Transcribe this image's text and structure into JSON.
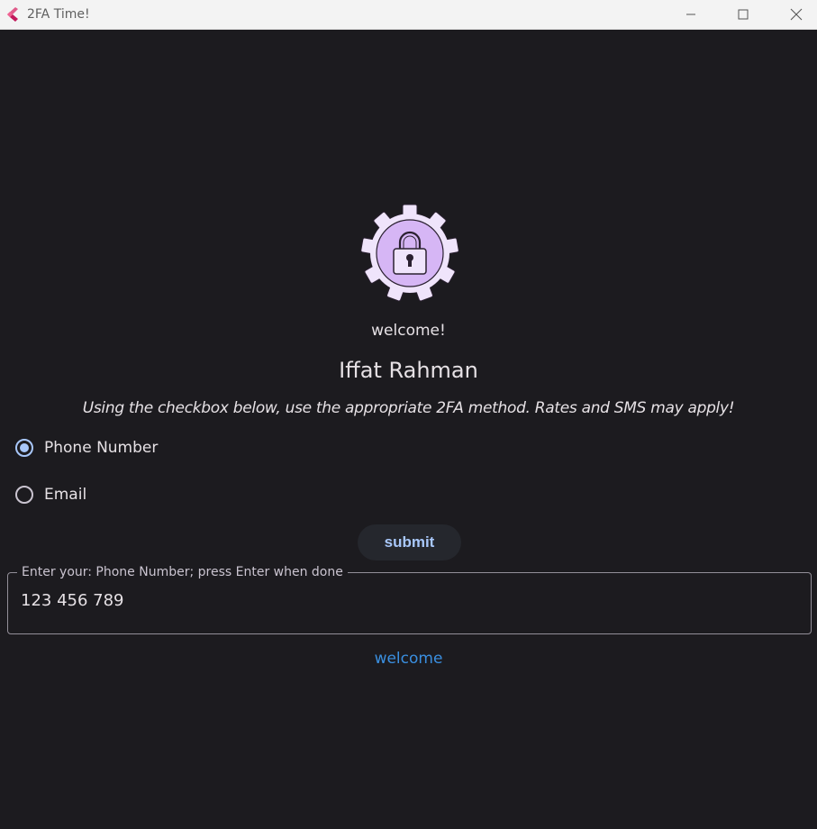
{
  "window": {
    "title": "2FA Time!",
    "app_icon": "flutter-logo-icon",
    "controls": [
      "minimize-icon",
      "maximize-icon",
      "close-icon"
    ]
  },
  "main": {
    "logo_icon": "gear-lock-icon",
    "greeting": "welcome!",
    "user_name": "Iffat Rahman",
    "instructions": "Using the checkbox below, use the appropriate 2FA method. Rates and SMS may apply!",
    "methods": [
      {
        "label": "Phone Number",
        "selected": true
      },
      {
        "label": "Email",
        "selected": false
      }
    ],
    "submit_label": "submit",
    "input": {
      "label": "Enter your: Phone Number; press Enter when done",
      "value": "123 456 789"
    },
    "link_text": "welcome"
  },
  "colors": {
    "background": "#1c1b1f",
    "accent": "#a8c7fa",
    "link": "#3a8fe0",
    "logo_fill": "#d6b6f5"
  }
}
